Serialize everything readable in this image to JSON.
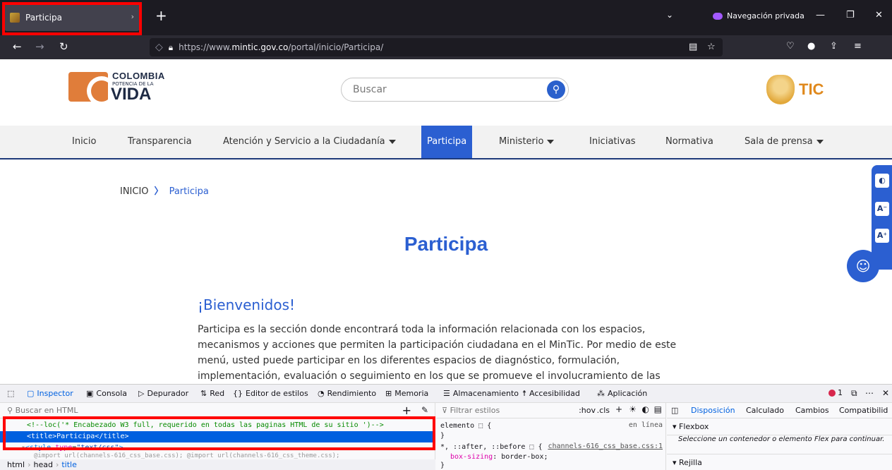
{
  "browser": {
    "tab_title": "Participa",
    "private_label": "Navegación privada",
    "url_prefix": "https://www.",
    "url_domain": "mintic.gov.co",
    "url_path": "/portal/inicio/Participa/"
  },
  "header": {
    "logo_line1": "COLOMBIA",
    "logo_line2": "POTENCIA DE LA",
    "logo_line3": "VIDA",
    "search_placeholder": "Buscar",
    "right_logo": "TIC"
  },
  "mainnav": {
    "items": [
      {
        "label": "Inicio"
      },
      {
        "label": "Transparencia"
      },
      {
        "label": "Atención y Servicio a la Ciudadanía"
      },
      {
        "label": "Participa"
      },
      {
        "label": "Ministerio"
      },
      {
        "label": "Iniciativas"
      },
      {
        "label": "Normativa"
      },
      {
        "label": "Sala de prensa"
      }
    ]
  },
  "breadcrumb": {
    "home": "INICIO",
    "current": "Participa"
  },
  "content": {
    "title": "Participa",
    "welcome": "¡Bienvenidos!",
    "paragraph": "Participa es la sección donde encontrará toda la información relacionada con los espacios, mecanismos y acciones que permiten la participación ciudadana en el MinTic. Por medio de este menú, usted puede participar en los diferentes espacios de diagnóstico, formulación, implementación, evaluación o seguimiento en los que se promueve el involucramiento de las"
  },
  "accessibility": {
    "contrast": "◐",
    "font_down": "A⁻",
    "font_up": "A⁺"
  },
  "devtools": {
    "tabs": [
      "Inspector",
      "Consola",
      "Depurador",
      "Red",
      "Editor de estilos",
      "Rendimiento",
      "Memoria",
      "Almacenamiento",
      "Accesibilidad",
      "Aplicación"
    ],
    "error_count": "1",
    "html_search_placeholder": "Buscar en HTML",
    "code": {
      "comment": "<!--loc('* Encabezado W3 full, requerido en todas las paginas HTML de su sitio ')-->",
      "title_line": "<title>Participa</title>",
      "style_tag": "style",
      "style_attr": "type",
      "style_val": "\"text/css\"",
      "import_line": "@import url(channels-616_css_base.css); @import url(channels-616_css_theme.css);"
    },
    "crumbs": [
      "html",
      "head",
      "title"
    ],
    "rules": {
      "filter_placeholder": "Filtrar estilos",
      "hov": ":hov",
      "cls": ".cls",
      "element_rule": "elemento ⬚ {",
      "inline": "en línea",
      "close": "}",
      "universal": "*, ::after, ::before ⬚ {",
      "universal_src": "channels-616_css_base.css:1",
      "prop": "box-sizing",
      "val": "border-box;"
    },
    "layout": {
      "tabs": [
        "Disposición",
        "Calculado",
        "Cambios",
        "Compatibilid"
      ],
      "flexbox": "Flexbox",
      "flex_msg": "Seleccione un contenedor o elemento Flex para continuar.",
      "grid": "Rejilla"
    }
  }
}
